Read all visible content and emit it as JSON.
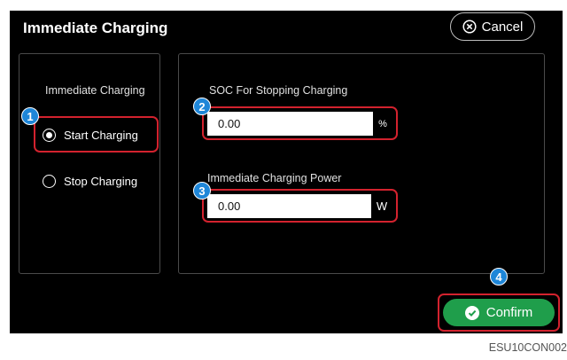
{
  "header": {
    "title": "Immediate Charging",
    "cancel_label": "Cancel"
  },
  "left_panel": {
    "heading": "Immediate Charging",
    "options": [
      {
        "label": "Start Charging",
        "selected": true
      },
      {
        "label": "Stop Charging",
        "selected": false
      }
    ]
  },
  "fields": {
    "soc": {
      "label": "SOC For Stopping Charging",
      "value": "0.00",
      "unit": "%"
    },
    "power": {
      "label": "Immediate Charging Power",
      "value": "0.00",
      "unit": "W"
    }
  },
  "confirm_label": "Confirm",
  "badges": [
    "1",
    "2",
    "3",
    "4"
  ],
  "figure_code": "ESU10CON002",
  "colors": {
    "highlight": "#d3222e",
    "badge": "#1e86d8",
    "confirm": "#1f9e4b"
  }
}
